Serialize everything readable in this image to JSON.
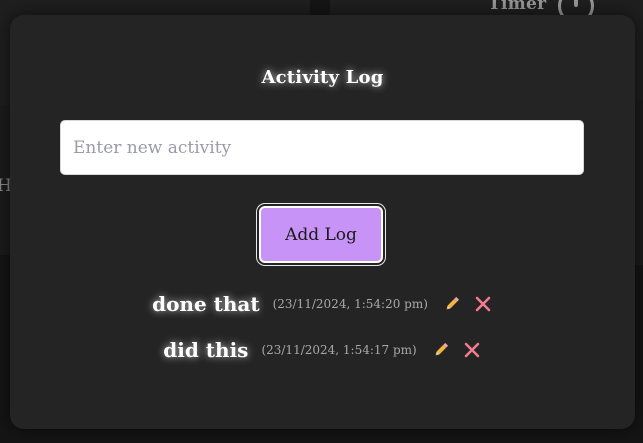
{
  "background": {
    "timer_label": "Timer",
    "partial_letter": "H"
  },
  "modal": {
    "title": "Activity Log",
    "input": {
      "placeholder": "Enter new activity",
      "value": ""
    },
    "add_button_label": "Add Log",
    "logs": [
      {
        "text": "done that",
        "timestamp": "(23/11/2024, 1:54:20 pm)"
      },
      {
        "text": "did this",
        "timestamp": "(23/11/2024, 1:54:17 pm)"
      }
    ],
    "icons": {
      "edit": "pencil-icon",
      "delete": "close-icon"
    }
  },
  "colors": {
    "modal_bg": "#242424",
    "accent_button": "#c893f7",
    "delete_icon": "#f07b8e",
    "edit_icon": "#f2b53d"
  }
}
